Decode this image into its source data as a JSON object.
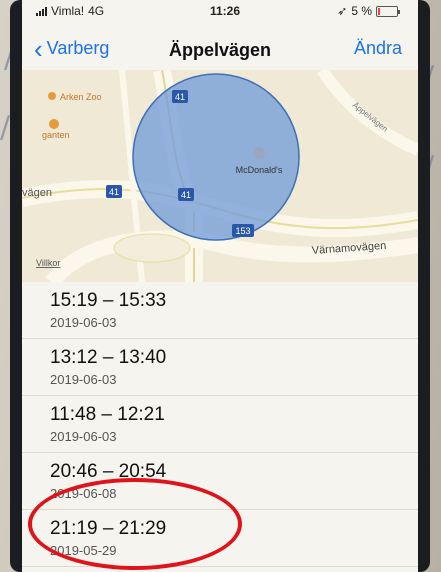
{
  "status_bar": {
    "carrier": "Vimla!",
    "network": "4G",
    "time": "11:26",
    "battery": "5 %"
  },
  "nav": {
    "back_label": "Varberg",
    "title": "Äppelvägen",
    "edit_label": "Ändra"
  },
  "map": {
    "labels": {
      "poi_left_1": "Arken Zoo",
      "poi_left_2": "ganten",
      "road_left": "vägen",
      "poi_center": "McDonald's",
      "road_bottom": "Värnamovägen",
      "road_diag": "Äppelvägen",
      "legal": "Villkor"
    },
    "route_shields": [
      "41",
      "41",
      "41",
      "153"
    ]
  },
  "visits": [
    {
      "range": "15:19 – 15:33",
      "date": "2019-06-03"
    },
    {
      "range": "13:12 – 13:40",
      "date": "2019-06-03"
    },
    {
      "range": "11:48 – 12:21",
      "date": "2019-06-03"
    },
    {
      "range": "20:46 – 20:54",
      "date": "2019-06-08"
    },
    {
      "range": "21:19 – 21:29",
      "date": "2019-05-29"
    }
  ],
  "colors": {
    "accent": "#1a73e8",
    "annotation": "#e0131a",
    "geofence_fill": "#6f9ad8",
    "road_shield": "#2a57a8"
  }
}
